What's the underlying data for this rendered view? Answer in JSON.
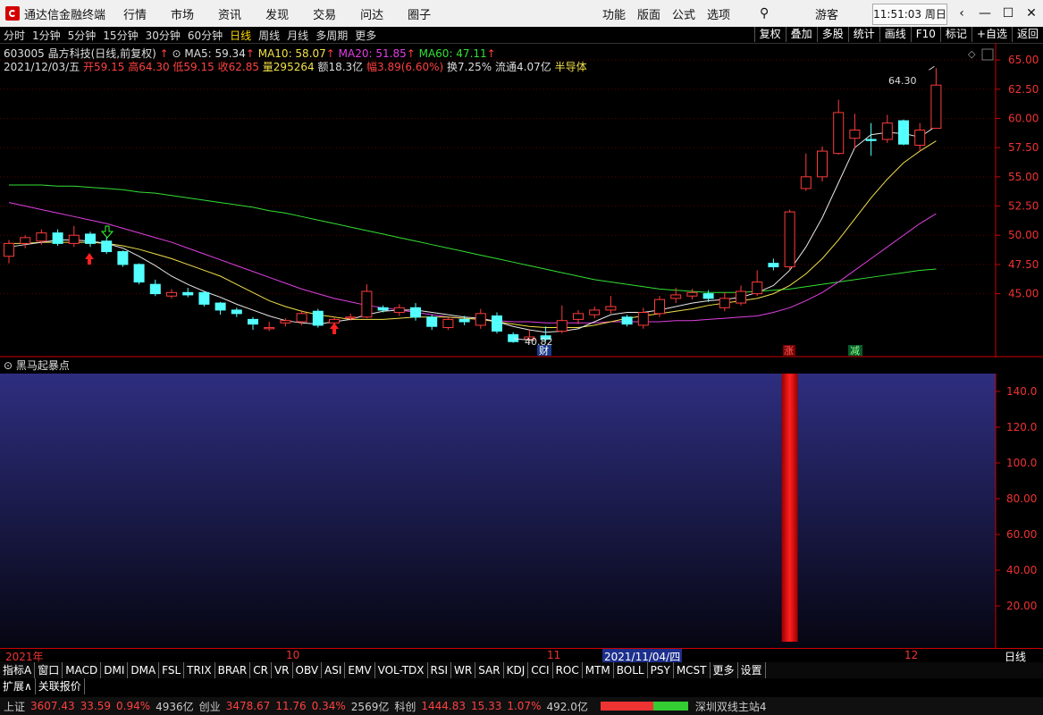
{
  "app": {
    "title": "通达信金融终端",
    "menu": [
      "行情",
      "市场",
      "资讯",
      "发现",
      "交易",
      "问达",
      "圈子"
    ],
    "right_menu": [
      "功能",
      "版面",
      "公式",
      "选项"
    ],
    "guest": "游客",
    "clock": "11:51:03 周日"
  },
  "period_tabs": [
    "分时",
    "1分钟",
    "5分钟",
    "15分钟",
    "30分钟",
    "60分钟",
    "日线",
    "周线",
    "月线",
    "多周期",
    "更多"
  ],
  "active_period": "日线",
  "right_tabs": [
    "复权",
    "叠加",
    "多股",
    "统计",
    "画线",
    "F10",
    "标记",
    "+自选",
    "返回"
  ],
  "stock": {
    "header": "603005 晶方科技(日线,前复权)",
    "ma5": "MA5: 59.34",
    "ma10": "MA10: 58.07",
    "ma20": "MA20: 51.85",
    "ma60": "MA60: 47.11"
  },
  "quote": {
    "date": "2021/12/03/五",
    "open": "开59.15",
    "high": "高64.30",
    "low": "低59.15",
    "close": "收62.85",
    "vol": "量295264",
    "amount": "额18.3亿",
    "range": "幅3.89(6.60%)",
    "turnover": "换7.25%",
    "float": "流通4.07亿",
    "sector": "半导体"
  },
  "price_axis": [
    "65.00",
    "62.50",
    "60.00",
    "57.50",
    "55.00",
    "52.50",
    "50.00",
    "47.50",
    "45.00"
  ],
  "annotations": {
    "high_label": "64.30",
    "low_label": "40.82",
    "cai": "财",
    "zhang": "涨",
    "jian": "减"
  },
  "indicator": {
    "title": "黑马起暴点",
    "axis": [
      "140.0",
      "120.0",
      "100.0",
      "80.00",
      "60.00",
      "40.00",
      "20.00"
    ]
  },
  "time_axis": {
    "y2021": "2021年",
    "m10": "10",
    "m11": "11",
    "cursor": "2021/11/04/四",
    "m12": "12",
    "period": "日线"
  },
  "indicator_tabs": [
    "指标A",
    "窗口",
    "MACD",
    "DMI",
    "DMA",
    "FSL",
    "TRIX",
    "BRAR",
    "CR",
    "VR",
    "OBV",
    "ASI",
    "EMV",
    "VOL-TDX",
    "RSI",
    "WR",
    "SAR",
    "KDJ",
    "CCI",
    "ROC",
    "MTM",
    "BOLL",
    "PSY",
    "MCST",
    "更多",
    "设置"
  ],
  "expand_tabs": [
    "扩展∧",
    "关联报价"
  ],
  "status": {
    "sh_label": "上证",
    "sh": "3607.43",
    "sh_chg": "33.59",
    "sh_pct": "0.94%",
    "sh_amt": "4936亿",
    "cy_label": "创业",
    "cy": "3478.67",
    "cy_chg": "11.76",
    "cy_pct": "0.34%",
    "cy_amt": "2569亿",
    "kc_label": "科创",
    "kc": "1444.83",
    "kc_chg": "15.33",
    "kc_pct": "1.07%",
    "kc_amt": "492.0亿",
    "server": "深圳双线主站4"
  },
  "colors": {
    "up": "#ff3b3b",
    "down": "#54ffff",
    "ma5": "#e8e8e8",
    "ma10": "#f2e04a",
    "ma20": "#e040e0",
    "ma60": "#33e033"
  },
  "chart_data": {
    "type": "candlestick",
    "ylim": [
      40,
      66
    ],
    "candles": [
      {
        "o": 48.2,
        "c": 49.3,
        "h": 49.6,
        "l": 47.6
      },
      {
        "o": 49.3,
        "c": 49.8,
        "h": 50.0,
        "l": 48.9
      },
      {
        "o": 49.5,
        "c": 50.2,
        "h": 50.5,
        "l": 49.2
      },
      {
        "o": 50.2,
        "c": 49.3,
        "h": 50.5,
        "l": 49.1
      },
      {
        "o": 49.3,
        "c": 50.0,
        "h": 50.8,
        "l": 49.0
      },
      {
        "o": 50.1,
        "c": 49.3,
        "h": 50.3,
        "l": 49.0
      },
      {
        "o": 49.5,
        "c": 48.6,
        "h": 49.9,
        "l": 48.4
      },
      {
        "o": 48.6,
        "c": 47.5,
        "h": 48.7,
        "l": 47.3
      },
      {
        "o": 47.5,
        "c": 46.0,
        "h": 47.6,
        "l": 45.8
      },
      {
        "o": 45.8,
        "c": 45.0,
        "h": 46.2,
        "l": 44.8
      },
      {
        "o": 44.8,
        "c": 45.1,
        "h": 45.4,
        "l": 44.6
      },
      {
        "o": 45.1,
        "c": 44.9,
        "h": 45.5,
        "l": 44.7
      },
      {
        "o": 45.1,
        "c": 44.1,
        "h": 45.2,
        "l": 43.9
      },
      {
        "o": 44.2,
        "c": 43.6,
        "h": 44.3,
        "l": 43.2
      },
      {
        "o": 43.6,
        "c": 43.3,
        "h": 43.8,
        "l": 43.0
      },
      {
        "o": 42.8,
        "c": 42.4,
        "h": 43.0,
        "l": 41.9
      },
      {
        "o": 42.0,
        "c": 42.1,
        "h": 42.6,
        "l": 41.8
      },
      {
        "o": 42.5,
        "c": 42.7,
        "h": 42.9,
        "l": 42.2
      },
      {
        "o": 42.6,
        "c": 43.3,
        "h": 43.6,
        "l": 42.3
      },
      {
        "o": 43.5,
        "c": 42.3,
        "h": 43.7,
        "l": 42.1
      },
      {
        "o": 42.5,
        "c": 42.8,
        "h": 43.0,
        "l": 42.2
      },
      {
        "o": 42.9,
        "c": 43.0,
        "h": 43.3,
        "l": 42.7
      },
      {
        "o": 43.0,
        "c": 45.2,
        "h": 45.8,
        "l": 42.9
      },
      {
        "o": 43.8,
        "c": 43.6,
        "h": 44.0,
        "l": 43.4
      },
      {
        "o": 43.4,
        "c": 43.8,
        "h": 44.1,
        "l": 43.1
      },
      {
        "o": 43.8,
        "c": 43.0,
        "h": 44.2,
        "l": 42.7
      },
      {
        "o": 43.0,
        "c": 42.2,
        "h": 43.2,
        "l": 41.9
      },
      {
        "o": 42.1,
        "c": 42.8,
        "h": 43.0,
        "l": 41.9
      },
      {
        "o": 42.8,
        "c": 42.6,
        "h": 43.1,
        "l": 42.3
      },
      {
        "o": 42.3,
        "c": 43.3,
        "h": 43.7,
        "l": 42.0
      },
      {
        "o": 43.1,
        "c": 41.8,
        "h": 43.4,
        "l": 41.6
      },
      {
        "o": 41.5,
        "c": 40.9,
        "h": 41.7,
        "l": 40.8
      },
      {
        "o": 41.1,
        "c": 41.3,
        "h": 41.9,
        "l": 40.9
      },
      {
        "o": 41.4,
        "c": 41.1,
        "h": 42.2,
        "l": 40.9
      },
      {
        "o": 41.8,
        "c": 42.7,
        "h": 44.0,
        "l": 41.6
      },
      {
        "o": 42.8,
        "c": 43.3,
        "h": 43.6,
        "l": 42.4
      },
      {
        "o": 43.2,
        "c": 43.6,
        "h": 43.9,
        "l": 42.9
      },
      {
        "o": 43.6,
        "c": 43.9,
        "h": 44.8,
        "l": 43.3
      },
      {
        "o": 43.0,
        "c": 42.4,
        "h": 43.2,
        "l": 42.2
      },
      {
        "o": 42.3,
        "c": 43.4,
        "h": 43.8,
        "l": 42.0
      },
      {
        "o": 43.3,
        "c": 44.5,
        "h": 44.8,
        "l": 43.0
      },
      {
        "o": 44.6,
        "c": 44.9,
        "h": 45.5,
        "l": 44.2
      },
      {
        "o": 44.8,
        "c": 45.1,
        "h": 45.4,
        "l": 44.5
      },
      {
        "o": 45.0,
        "c": 44.6,
        "h": 45.3,
        "l": 44.3
      },
      {
        "o": 43.8,
        "c": 44.6,
        "h": 45.1,
        "l": 43.5
      },
      {
        "o": 44.2,
        "c": 45.2,
        "h": 45.7,
        "l": 44.0
      },
      {
        "o": 45.0,
        "c": 46.0,
        "h": 47.0,
        "l": 44.8
      },
      {
        "o": 47.6,
        "c": 47.3,
        "h": 48.0,
        "l": 47.0
      },
      {
        "o": 47.3,
        "c": 52.0,
        "h": 52.2,
        "l": 47.1
      },
      {
        "o": 54.0,
        "c": 55.0,
        "h": 57.0,
        "l": 53.8
      },
      {
        "o": 55.0,
        "c": 57.2,
        "h": 57.6,
        "l": 54.6
      },
      {
        "o": 57.0,
        "c": 60.5,
        "h": 61.6,
        "l": 56.9
      },
      {
        "o": 58.3,
        "c": 59.0,
        "h": 60.4,
        "l": 57.4
      },
      {
        "o": 58.2,
        "c": 58.1,
        "h": 59.6,
        "l": 56.8
      },
      {
        "o": 58.2,
        "c": 59.6,
        "h": 60.3,
        "l": 57.9
      },
      {
        "o": 59.8,
        "c": 57.8,
        "h": 59.9,
        "l": 57.7
      },
      {
        "o": 57.7,
        "c": 59.0,
        "h": 59.6,
        "l": 57.2
      },
      {
        "o": 59.15,
        "c": 62.85,
        "h": 64.3,
        "l": 59.15
      }
    ],
    "ma5": [
      49.0,
      49.2,
      49.4,
      49.6,
      49.6,
      49.5,
      49.3,
      48.9,
      48.2,
      47.4,
      46.5,
      45.8,
      45.2,
      44.7,
      44.1,
      43.6,
      43.1,
      42.7,
      42.5,
      42.4,
      42.6,
      42.8,
      43.2,
      43.5,
      43.6,
      43.6,
      43.4,
      43.2,
      43.0,
      42.9,
      42.6,
      42.2,
      41.9,
      41.7,
      41.8,
      42.0,
      42.6,
      43.2,
      43.4,
      43.4,
      43.6,
      43.9,
      44.2,
      44.4,
      44.5,
      44.7,
      45.1,
      45.7,
      47.0,
      49.0,
      51.5,
      54.5,
      57.5,
      58.6,
      58.8,
      58.7,
      58.4,
      59.34
    ],
    "ma10": [
      49.3,
      49.3,
      49.4,
      49.4,
      49.4,
      49.4,
      49.3,
      49.1,
      48.8,
      48.4,
      48.0,
      47.5,
      47.0,
      46.5,
      45.8,
      45.1,
      44.4,
      43.9,
      43.5,
      43.2,
      43.0,
      42.8,
      42.8,
      42.8,
      42.9,
      43.0,
      43.0,
      43.0,
      42.9,
      42.8,
      42.6,
      42.4,
      42.2,
      42.1,
      42.1,
      42.1,
      42.3,
      42.6,
      42.9,
      43.1,
      43.3,
      43.5,
      43.7,
      44.0,
      44.2,
      44.4,
      44.6,
      45.0,
      45.7,
      46.7,
      48.0,
      49.6,
      51.4,
      53.2,
      54.8,
      56.2,
      57.2,
      58.07
    ],
    "ma20": [
      52.8,
      52.5,
      52.2,
      51.9,
      51.6,
      51.3,
      51.0,
      50.6,
      50.2,
      49.8,
      49.4,
      48.9,
      48.4,
      47.9,
      47.4,
      46.9,
      46.4,
      45.9,
      45.4,
      45.0,
      44.6,
      44.3,
      44.0,
      43.8,
      43.6,
      43.4,
      43.2,
      43.0,
      42.9,
      42.8,
      42.7,
      42.6,
      42.6,
      42.5,
      42.5,
      42.5,
      42.5,
      42.6,
      42.6,
      42.6,
      42.6,
      42.7,
      42.7,
      42.8,
      42.9,
      43.0,
      43.1,
      43.4,
      43.8,
      44.4,
      45.1,
      46.0,
      47.0,
      48.0,
      49.0,
      50.0,
      51.0,
      51.85
    ],
    "ma60": [
      54.3,
      54.3,
      54.3,
      54.2,
      54.2,
      54.1,
      54.0,
      53.9,
      53.7,
      53.6,
      53.4,
      53.2,
      53.0,
      52.8,
      52.6,
      52.4,
      52.1,
      51.9,
      51.6,
      51.3,
      51.0,
      50.7,
      50.4,
      50.1,
      49.8,
      49.5,
      49.2,
      48.9,
      48.6,
      48.3,
      48.0,
      47.7,
      47.4,
      47.1,
      46.8,
      46.5,
      46.2,
      46.0,
      45.8,
      45.6,
      45.4,
      45.3,
      45.2,
      45.1,
      45.1,
      45.1,
      45.2,
      45.3,
      45.4,
      45.6,
      45.8,
      46.0,
      46.2,
      46.4,
      46.6,
      46.8,
      47.0,
      47.11
    ],
    "indicator_ylim": [
      0,
      150
    ],
    "indicator_bar_index": 48,
    "indicator_bar_value": 150
  }
}
